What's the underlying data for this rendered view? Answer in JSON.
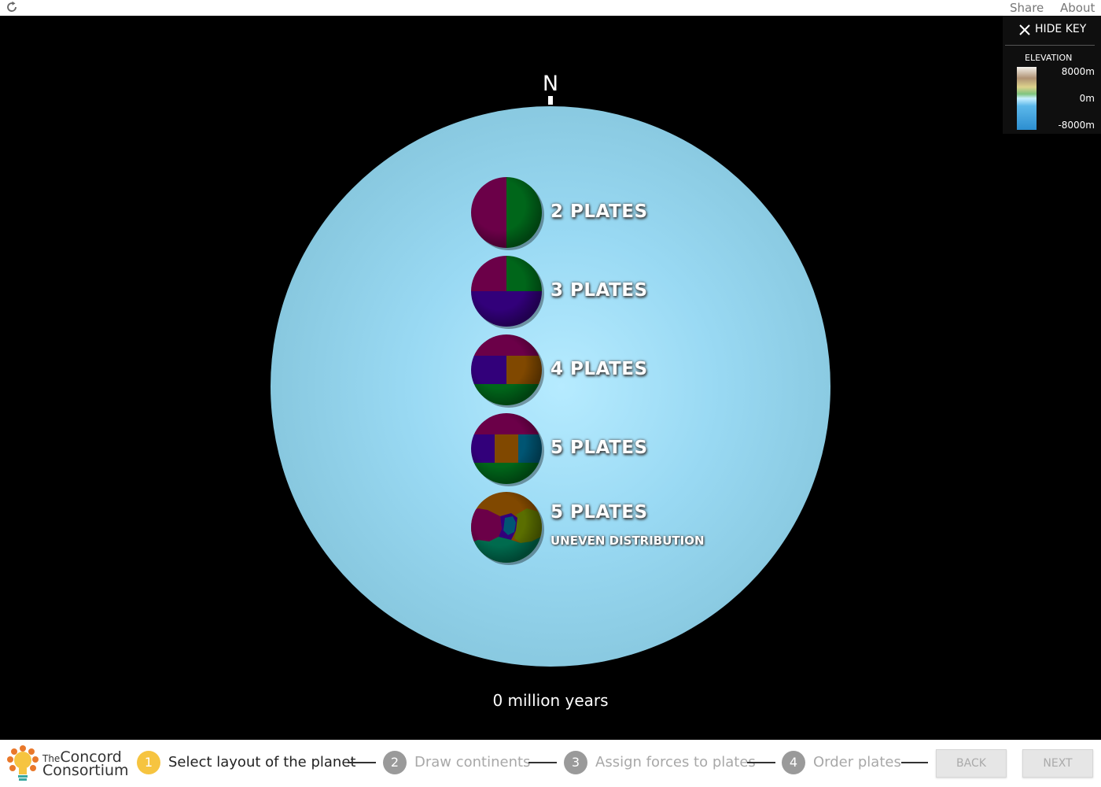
{
  "toolbar": {
    "share_label": "Share",
    "about_label": "About"
  },
  "key": {
    "hide_label": "HIDE KEY",
    "elevation_title": "ELEVATION",
    "elevation_max": "8000m",
    "elevation_mid": "0m",
    "elevation_min": "-8000m"
  },
  "compass": {
    "north_label": "N"
  },
  "plate_options": [
    {
      "label": "2 PLATES",
      "colors": [
        "#6b0048",
        "#00661a"
      ]
    },
    {
      "label": "3 PLATES",
      "colors": [
        "#6b0048",
        "#00661a",
        "#32007a"
      ]
    },
    {
      "label": "4 PLATES",
      "colors": [
        "#6b0048",
        "#32007a",
        "#804800",
        "#00661a"
      ]
    },
    {
      "label": "5 PLATES",
      "colors": [
        "#6b0048",
        "#32007a",
        "#804800",
        "#005573",
        "#00661a"
      ]
    },
    {
      "label": "5 PLATES",
      "sublabel": "UNEVEN DISTRIBUTION",
      "colors": [
        "#804800",
        "#6b0048",
        "#32007a",
        "#005573",
        "#5a6e00",
        "#006b4e"
      ]
    }
  ],
  "timeline": {
    "time_label": "0 million years"
  },
  "logo": {
    "line1_small": "The",
    "line1": "Concord",
    "line2": "Consortium"
  },
  "steps": [
    {
      "number": "1",
      "label": "Select layout of the planet",
      "active": true
    },
    {
      "number": "2",
      "label": "Draw continents",
      "active": false
    },
    {
      "number": "3",
      "label": "Assign forces to plates",
      "active": false
    },
    {
      "number": "4",
      "label": "Order plates",
      "active": false
    }
  ],
  "nav": {
    "back_label": "BACK",
    "next_label": "NEXT"
  },
  "colors": {
    "active_step": "#f6c440",
    "inactive_step": "#9a9a9a",
    "ocean": "#99d9f3"
  }
}
